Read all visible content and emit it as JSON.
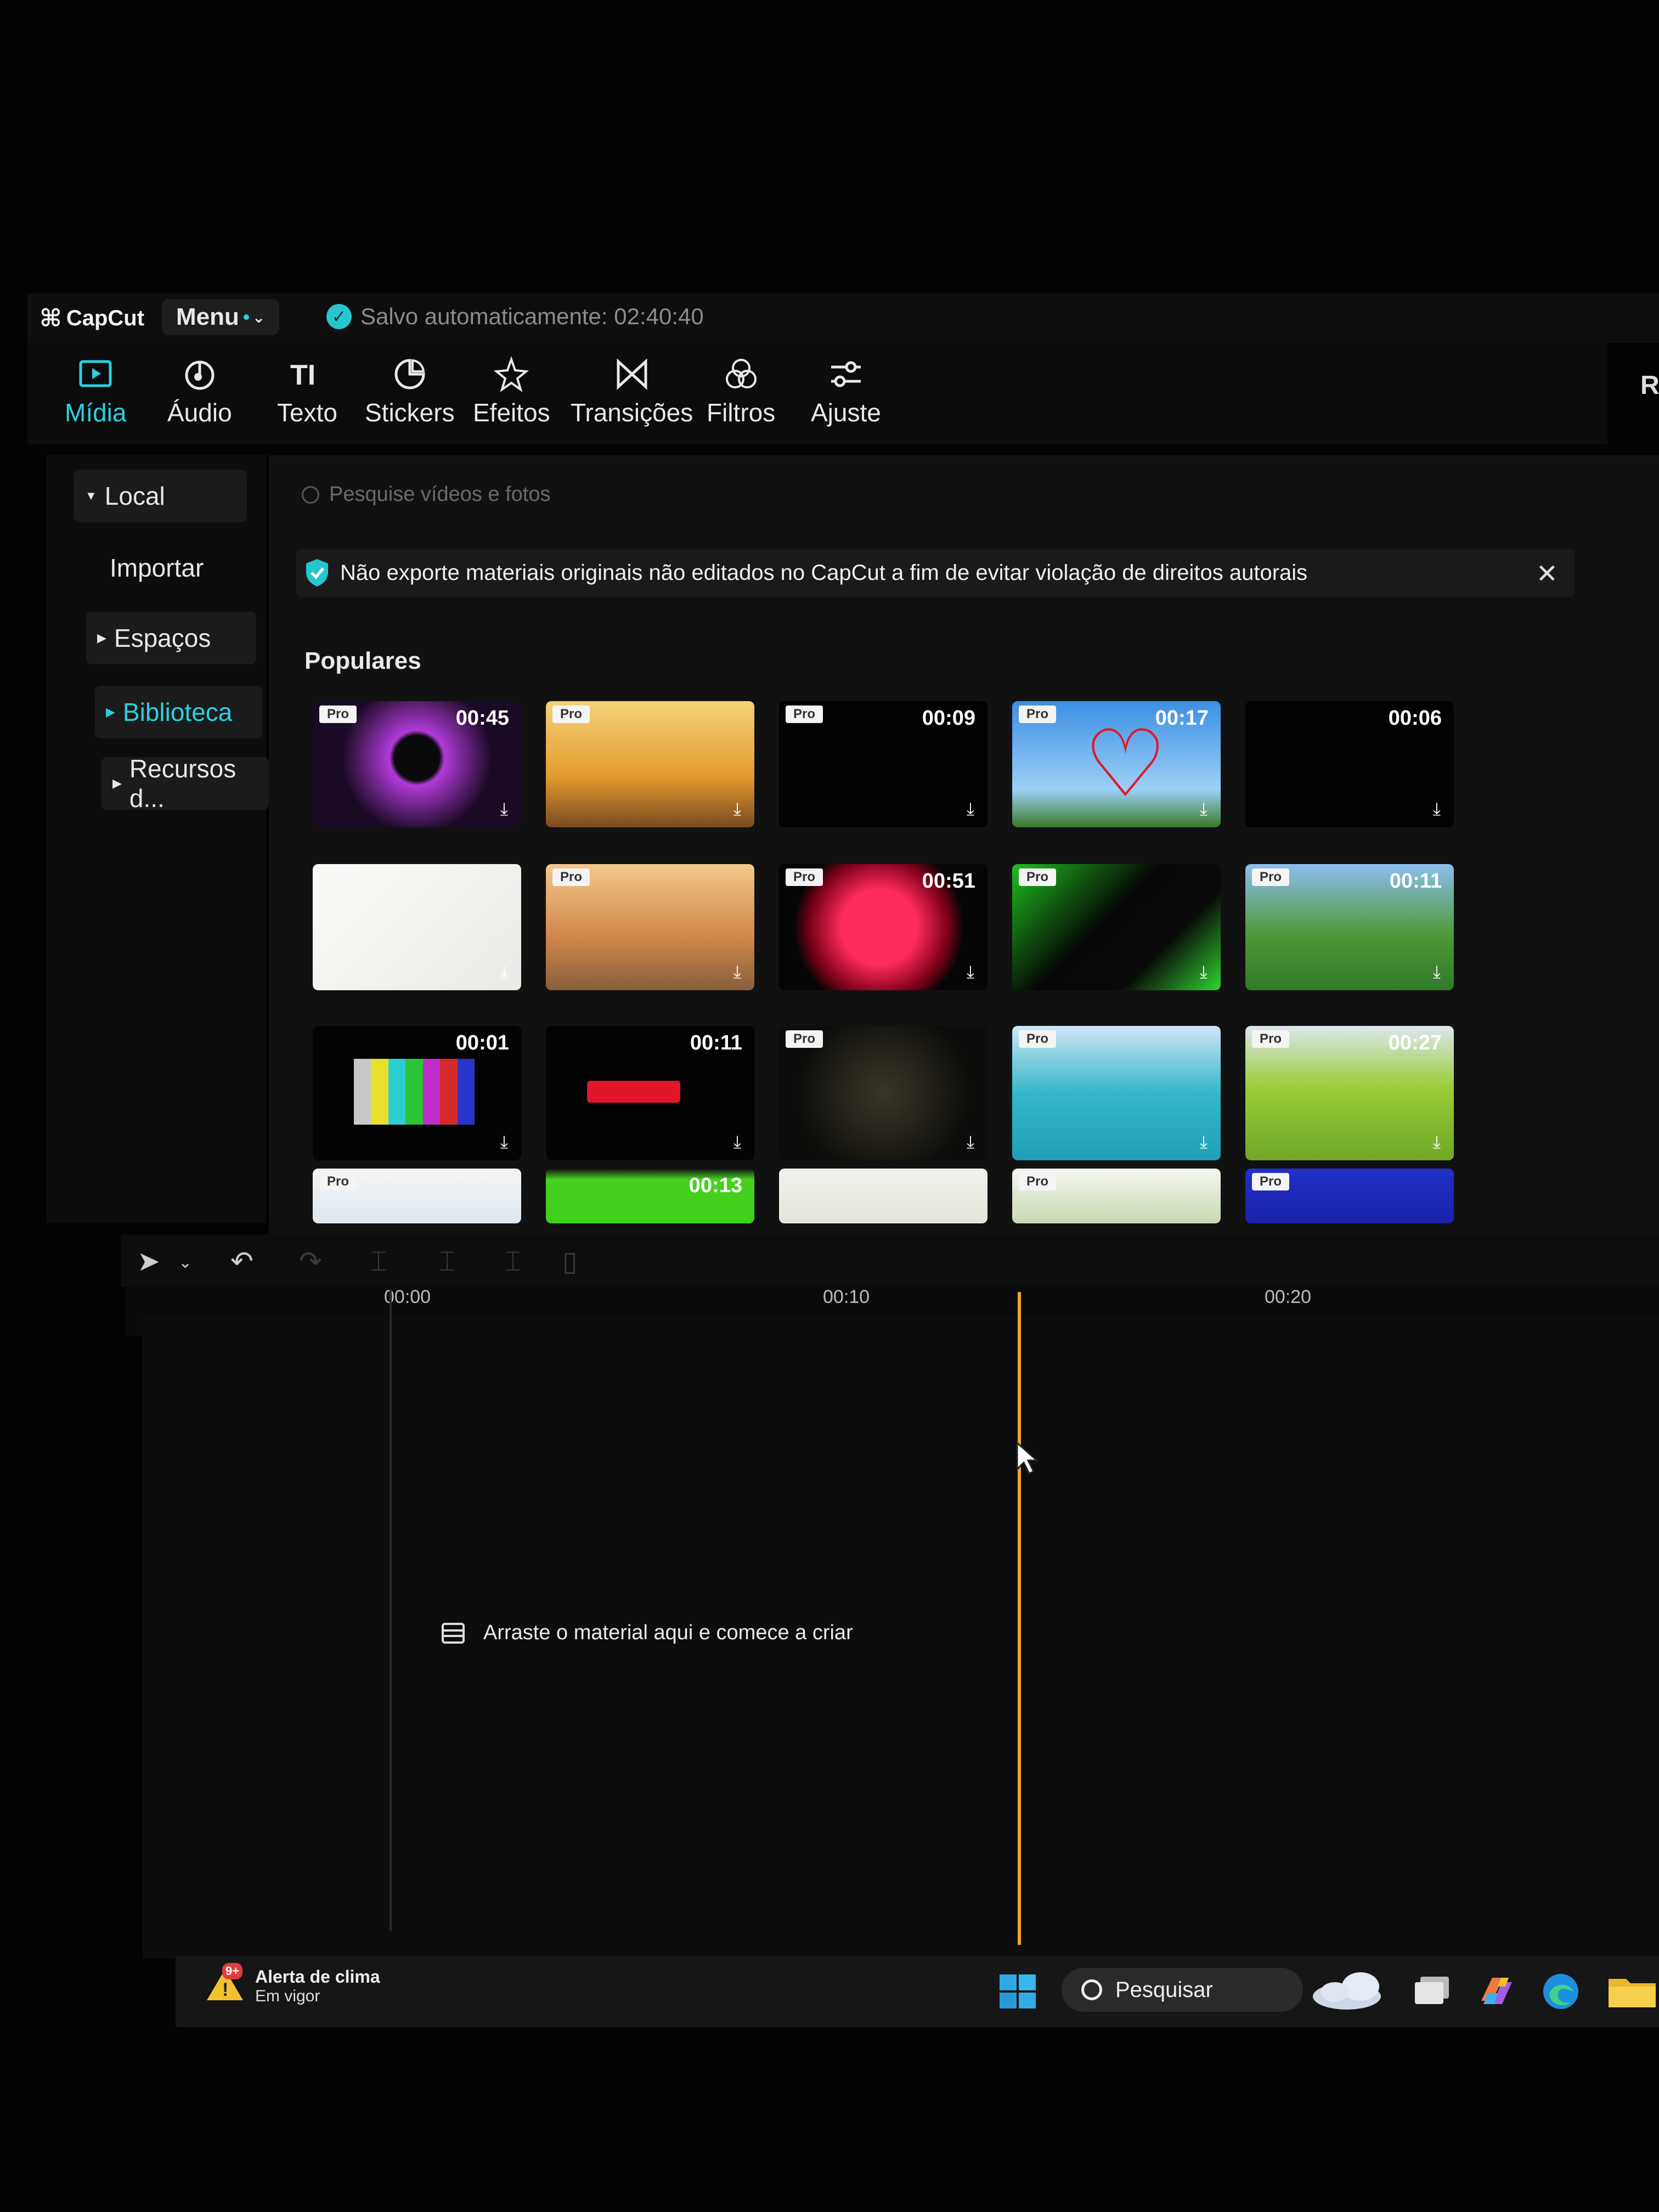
{
  "app": {
    "brand": "CapCut",
    "menu_label": "Menu",
    "autosave_text": "Salvo automaticamente: 02:40:40"
  },
  "toolbar": {
    "tabs": [
      {
        "label": "Mídia",
        "icon": "media-play-icon",
        "active": true
      },
      {
        "label": "Áudio",
        "icon": "audio-icon",
        "active": false
      },
      {
        "label": "Texto",
        "icon": "text-icon",
        "active": false
      },
      {
        "label": "Stickers",
        "icon": "sticker-icon",
        "active": false
      },
      {
        "label": "Efeitos",
        "icon": "effects-star-icon",
        "active": false
      },
      {
        "label": "Transições",
        "icon": "transition-bowtie-icon",
        "active": false
      },
      {
        "label": "Filtros",
        "icon": "filters-icon",
        "active": false
      },
      {
        "label": "Ajuste",
        "icon": "sliders-icon",
        "active": false
      }
    ],
    "right_partial": "R"
  },
  "sidebar": {
    "items": [
      {
        "label": "Local"
      },
      {
        "label": "Importar"
      },
      {
        "label": "Espaços"
      },
      {
        "label": "Biblioteca"
      },
      {
        "label": "Recursos d..."
      }
    ]
  },
  "main": {
    "search_placeholder": "Pesquise vídeos e fotos",
    "notice": "Não exporte materiais originais não editados no CapCut a fim de evitar violação de direitos autorais",
    "section_title": "Populares",
    "pro_label": "Pro",
    "thumbs": [
      {
        "duration": "00:45"
      },
      {
        "duration": ""
      },
      {
        "duration": "00:09"
      },
      {
        "duration": "00:17"
      },
      {
        "duration": "00:06"
      },
      {
        "duration": ""
      },
      {
        "duration": ""
      },
      {
        "duration": "00:51"
      },
      {
        "duration": ""
      },
      {
        "duration": "00:11"
      },
      {
        "duration": "00:01"
      },
      {
        "duration": "00:11"
      },
      {
        "duration": ""
      },
      {
        "duration": ""
      },
      {
        "duration": "00:27"
      },
      {
        "duration": ""
      },
      {
        "duration": "00:13"
      },
      {
        "duration": ""
      },
      {
        "duration": ""
      },
      {
        "duration": ""
      }
    ]
  },
  "timeline": {
    "ruler": [
      "00:00",
      "00:10",
      "00:20"
    ],
    "drop_hint": "Arraste o material aqui e comece a criar",
    "playhead_color": "#f0a52a"
  },
  "taskbar": {
    "weather_title": "Alerta de clima",
    "weather_sub": "Em vigor",
    "weather_badge": "9+",
    "search_label": "Pesquisar"
  }
}
